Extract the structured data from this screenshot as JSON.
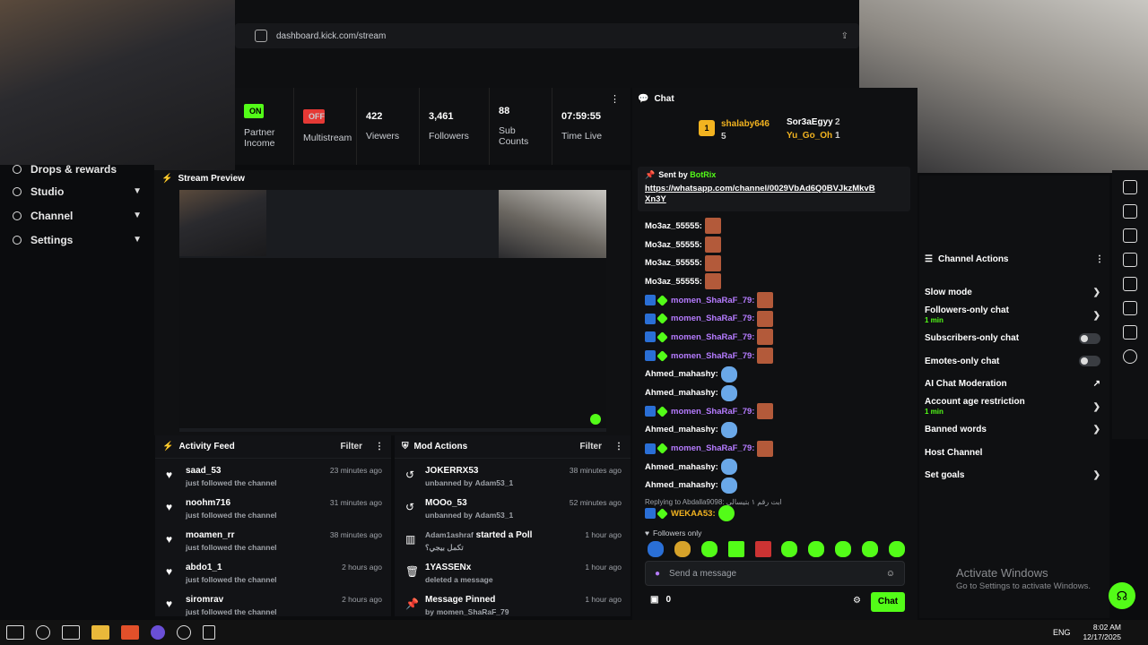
{
  "browser": {
    "url": "dashboard.kick.com/stream"
  },
  "stats": [
    {
      "pill": "ON",
      "label1": "Partner",
      "label2": "Income",
      "color": "#53fc18"
    },
    {
      "pill": "OFF",
      "label1": "Multistream",
      "label2": "",
      "color": "#e53935"
    },
    {
      "value": "422",
      "label": "Viewers"
    },
    {
      "value": "3,461",
      "label": "Followers"
    },
    {
      "value": "88",
      "label": "Sub Counts"
    },
    {
      "value": "07:59:55",
      "label": "Time Live"
    }
  ],
  "nav": [
    {
      "label": "Drops & rewards"
    },
    {
      "label": "Studio"
    },
    {
      "label": "Channel"
    },
    {
      "label": "Settings"
    }
  ],
  "preview": {
    "title": "Stream Preview"
  },
  "activity": {
    "title": "Activity Feed",
    "filter": "Filter",
    "items": [
      {
        "user": "saad_53",
        "text": "just followed the channel",
        "time": "23 minutes ago"
      },
      {
        "user": "noohm716",
        "text": "just followed the channel",
        "time": "31 minutes ago"
      },
      {
        "user": "moamen_rr",
        "text": "just followed the channel",
        "time": "38 minutes ago"
      },
      {
        "user": "abdo1_1",
        "text": "just followed the channel",
        "time": "2 hours ago"
      },
      {
        "user": "siromrav",
        "text": "just followed the channel",
        "time": "2 hours ago"
      }
    ]
  },
  "mod": {
    "title": "Mod Actions",
    "filter": "Filter",
    "items": [
      {
        "user": "JOKERRX53",
        "pre": "unbanned by",
        "by": "Adam53_1",
        "time": "38 minutes ago"
      },
      {
        "user": "MOOo_53",
        "pre": "unbanned by",
        "by": "Adam53_1",
        "time": "52 minutes ago"
      },
      {
        "user": "Adam1ashraf",
        "extra": "started a Poll",
        "pre": "تكمل بيجي؟",
        "by": "",
        "time": "1 hour ago"
      },
      {
        "user": "1YASSENx",
        "pre": "deleted a message",
        "by": "",
        "time": "1 hour ago"
      },
      {
        "user": "Message Pinned",
        "pre": "by",
        "by": "momen_ShaRaF_79",
        "time": "1 hour ago"
      }
    ]
  },
  "chat": {
    "title": "Chat",
    "leaderboard": {
      "first": "shalaby646",
      "first_count": "5",
      "second": "Sor3aEgyy",
      "second_count": "2",
      "third": "Yu_Go_Oh",
      "third_count": "1"
    },
    "pinned": {
      "by_label": "Sent by",
      "by": "BotRix",
      "link": "https://whatsapp.com/channel/0029VbAd6Q0BVJkzMkvB Xn3Y"
    },
    "messages": [
      {
        "user": "Mo3az_55555:",
        "style": "white",
        "emote": "face"
      },
      {
        "user": "Mo3az_55555:",
        "style": "white",
        "emote": "face"
      },
      {
        "user": "Mo3az_55555:",
        "style": "white",
        "emote": "face"
      },
      {
        "user": "Mo3az_55555:",
        "style": "white",
        "emote": "face"
      },
      {
        "user": "momen_ShaRaF_79:",
        "style": "purple",
        "emote": "face"
      },
      {
        "user": "momen_ShaRaF_79:",
        "style": "purple",
        "emote": "face"
      },
      {
        "user": "momen_ShaRaF_79:",
        "style": "purple",
        "emote": "face"
      },
      {
        "user": "momen_ShaRaF_79:",
        "style": "purple",
        "emote": "face"
      },
      {
        "user": "Ahmed_mahashy:",
        "style": "white",
        "emote": "blue"
      },
      {
        "user": "Ahmed_mahashy:",
        "style": "white",
        "emote": "blue"
      },
      {
        "user": "momen_ShaRaF_79:",
        "style": "purple",
        "emote": "face"
      },
      {
        "user": "Ahmed_mahashy:",
        "style": "white",
        "emote": "blue"
      },
      {
        "user": "momen_ShaRaF_79:",
        "style": "purple",
        "emote": "face"
      },
      {
        "user": "Ahmed_mahashy:",
        "style": "white",
        "emote": "blue"
      },
      {
        "user": "Ahmed_mahashy:",
        "style": "white",
        "emote": "blue"
      }
    ],
    "reply": "Replying to Abdalla9098: ابت رقم ١ بتيسالي",
    "last_user": "WEKAA53:",
    "followers_only": "Followers only",
    "placeholder": "Send a message",
    "points": "0",
    "send": "Chat"
  },
  "actions": {
    "title": "Channel Actions",
    "items": [
      {
        "label": "Slow mode",
        "sub": "",
        "ctl": "chev"
      },
      {
        "label": "Followers-only chat",
        "sub": "1 min",
        "ctl": "chev"
      },
      {
        "label": "Subscribers-only chat",
        "sub": "",
        "ctl": "toggle"
      },
      {
        "label": "Emotes-only chat",
        "sub": "",
        "ctl": "toggle"
      },
      {
        "label": "AI Chat Moderation",
        "sub": "",
        "ctl": "ext"
      },
      {
        "label": "Account age restriction",
        "sub": "1 min",
        "ctl": "chev"
      },
      {
        "label": "Banned words",
        "sub": "",
        "ctl": "chev"
      },
      {
        "label": "Host Channel",
        "sub": "",
        "ctl": "none"
      },
      {
        "label": "Set goals",
        "sub": "",
        "ctl": "chev"
      }
    ]
  },
  "watermark": {
    "line1": "Activate Windows",
    "line2": "Go to Settings to activate Windows."
  },
  "taskbar": {
    "lang": "ENG",
    "time": "8:02 AM",
    "date": "12/17/2025"
  }
}
